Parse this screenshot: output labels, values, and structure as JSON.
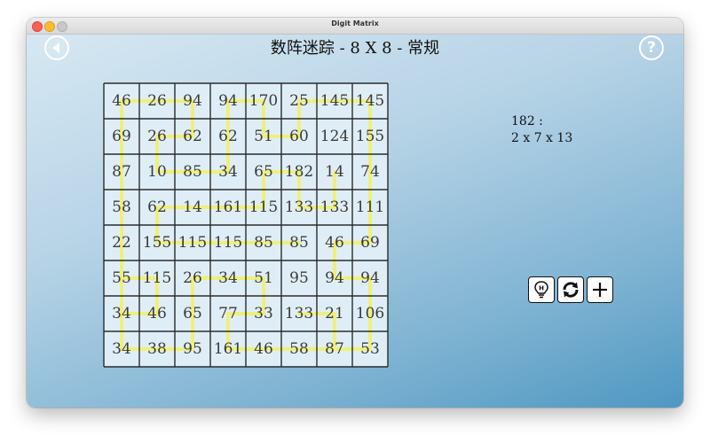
{
  "window": {
    "title": "Digit Matrix"
  },
  "header": {
    "puzzle_title": "数阵迷踪 - 8 X 8 - 常规"
  },
  "grid": {
    "rows": [
      [
        "46",
        "26",
        "94",
        "94",
        "170",
        "25",
        "145",
        "145"
      ],
      [
        "69",
        "26",
        "62",
        "62",
        "51",
        "60",
        "124",
        "155"
      ],
      [
        "87",
        "10",
        "85",
        "34",
        "65",
        "182",
        "14",
        "74"
      ],
      [
        "58",
        "62",
        "14",
        "161",
        "115",
        "133",
        "133",
        "111"
      ],
      [
        "22",
        "155",
        "115",
        "115",
        "85",
        "85",
        "46",
        "69"
      ],
      [
        "55",
        "115",
        "26",
        "34",
        "51",
        "95",
        "94",
        "94"
      ],
      [
        "34",
        "46",
        "65",
        "77",
        "33",
        "133",
        "21",
        "106"
      ],
      [
        "34",
        "38",
        "95",
        "161",
        "46",
        "58",
        "87",
        "53"
      ]
    ],
    "path_segments": [
      [
        [
          0,
          0
        ],
        [
          0,
          1
        ]
      ],
      [
        [
          0,
          1
        ],
        [
          0,
          2
        ]
      ],
      [
        [
          0,
          2
        ],
        [
          1,
          2
        ]
      ],
      [
        [
          1,
          1
        ],
        [
          1,
          2
        ]
      ],
      [
        [
          1,
          1
        ],
        [
          2,
          1
        ]
      ],
      [
        [
          2,
          1
        ],
        [
          2,
          2
        ]
      ],
      [
        [
          2,
          2
        ],
        [
          2,
          3
        ]
      ],
      [
        [
          2,
          3
        ],
        [
          1,
          3
        ]
      ],
      [
        [
          1,
          3
        ],
        [
          0,
          3
        ]
      ],
      [
        [
          0,
          3
        ],
        [
          0,
          4
        ]
      ],
      [
        [
          0,
          4
        ],
        [
          1,
          4
        ]
      ],
      [
        [
          1,
          4
        ],
        [
          1,
          5
        ]
      ],
      [
        [
          1,
          5
        ],
        [
          0,
          5
        ]
      ],
      [
        [
          0,
          5
        ],
        [
          0,
          6
        ]
      ],
      [
        [
          0,
          6
        ],
        [
          0,
          7
        ]
      ],
      [
        [
          0,
          7
        ],
        [
          1,
          7
        ]
      ],
      [
        [
          1,
          7
        ],
        [
          2,
          7
        ]
      ],
      [
        [
          2,
          7
        ],
        [
          3,
          7
        ]
      ],
      [
        [
          3,
          7
        ],
        [
          4,
          7
        ]
      ],
      [
        [
          4,
          7
        ],
        [
          4,
          6
        ]
      ],
      [
        [
          4,
          6
        ],
        [
          5,
          6
        ]
      ],
      [
        [
          5,
          6
        ],
        [
          5,
          7
        ]
      ],
      [
        [
          5,
          7
        ],
        [
          6,
          7
        ]
      ],
      [
        [
          6,
          7
        ],
        [
          7,
          7
        ]
      ],
      [
        [
          7,
          7
        ],
        [
          7,
          6
        ]
      ],
      [
        [
          7,
          6
        ],
        [
          6,
          6
        ]
      ],
      [
        [
          6,
          6
        ],
        [
          6,
          5
        ]
      ],
      [
        [
          2,
          4
        ],
        [
          2,
          5
        ]
      ],
      [
        [
          2,
          5
        ],
        [
          3,
          5
        ]
      ],
      [
        [
          3,
          5
        ],
        [
          3,
          6
        ]
      ],
      [
        [
          3,
          6
        ],
        [
          2,
          6
        ]
      ],
      [
        [
          2,
          4
        ],
        [
          3,
          4
        ]
      ],
      [
        [
          3,
          4
        ],
        [
          3,
          3
        ]
      ],
      [
        [
          3,
          3
        ],
        [
          3,
          2
        ]
      ],
      [
        [
          3,
          2
        ],
        [
          3,
          1
        ]
      ],
      [
        [
          3,
          1
        ],
        [
          4,
          1
        ]
      ],
      [
        [
          4,
          1
        ],
        [
          4,
          2
        ]
      ],
      [
        [
          4,
          2
        ],
        [
          4,
          3
        ]
      ],
      [
        [
          4,
          3
        ],
        [
          4,
          4
        ]
      ],
      [
        [
          4,
          4
        ],
        [
          4,
          5
        ]
      ],
      [
        [
          0,
          0
        ],
        [
          1,
          0
        ]
      ],
      [
        [
          1,
          0
        ],
        [
          2,
          0
        ]
      ],
      [
        [
          2,
          0
        ],
        [
          3,
          0
        ]
      ],
      [
        [
          3,
          0
        ],
        [
          4,
          0
        ]
      ],
      [
        [
          4,
          0
        ],
        [
          5,
          0
        ]
      ],
      [
        [
          5,
          0
        ],
        [
          6,
          0
        ]
      ],
      [
        [
          6,
          0
        ],
        [
          7,
          0
        ]
      ],
      [
        [
          7,
          0
        ],
        [
          7,
          1
        ]
      ],
      [
        [
          7,
          1
        ],
        [
          7,
          2
        ]
      ],
      [
        [
          7,
          2
        ],
        [
          6,
          2
        ]
      ],
      [
        [
          6,
          2
        ],
        [
          5,
          2
        ]
      ],
      [
        [
          5,
          2
        ],
        [
          5,
          3
        ]
      ],
      [
        [
          5,
          3
        ],
        [
          5,
          4
        ]
      ],
      [
        [
          5,
          4
        ],
        [
          6,
          4
        ]
      ],
      [
        [
          6,
          4
        ],
        [
          6,
          3
        ]
      ],
      [
        [
          6,
          3
        ],
        [
          7,
          3
        ]
      ],
      [
        [
          7,
          3
        ],
        [
          7,
          4
        ]
      ],
      [
        [
          7,
          4
        ],
        [
          7,
          5
        ]
      ],
      [
        [
          7,
          5
        ],
        [
          7,
          6
        ]
      ],
      [
        [
          5,
          0
        ],
        [
          5,
          1
        ]
      ],
      [
        [
          5,
          1
        ],
        [
          6,
          1
        ]
      ],
      [
        [
          6,
          1
        ],
        [
          6,
          0
        ]
      ]
    ],
    "path_color": "#eef07a",
    "grid_line_color": "#2b2b2b",
    "cell_background": "#dfeef6"
  },
  "info": {
    "number": "182 :",
    "factors": "2 x 7 x 13"
  },
  "toolbar": {
    "hint_icon": "lightbulb-icon",
    "reset_icon": "refresh-icon",
    "add_icon": "plus-icon"
  },
  "colors": {
    "accent": "#ffffff",
    "background_top": "#d9e9f3",
    "background_bottom": "#4f98c1"
  }
}
